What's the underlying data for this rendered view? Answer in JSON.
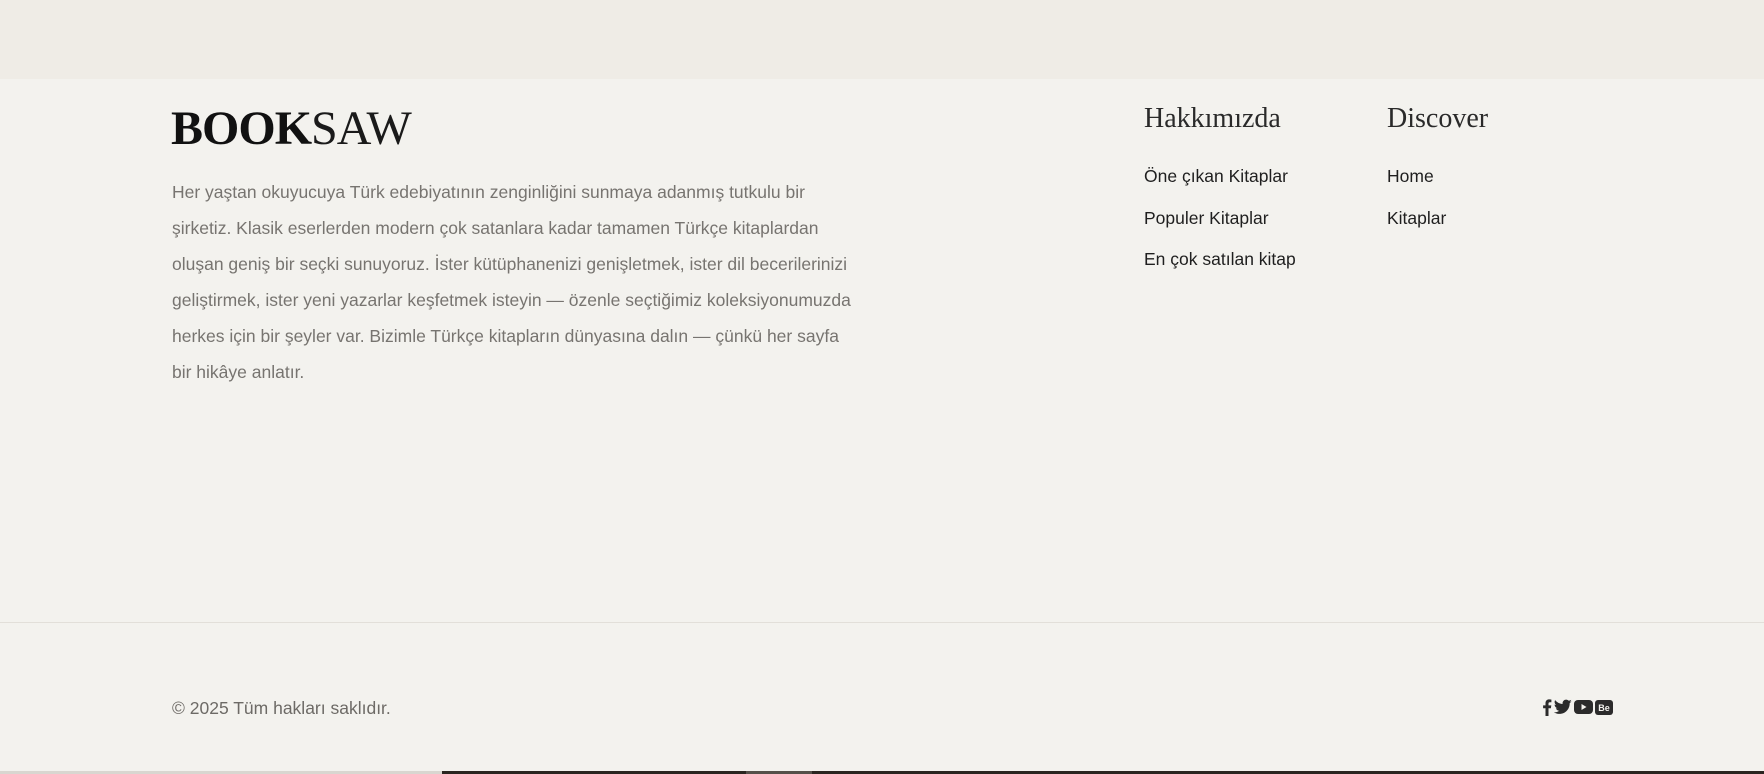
{
  "brand": {
    "logo_bold": "BOOK",
    "logo_light": "SAW"
  },
  "about": {
    "text": "Her yaştan okuyucuya Türk edebiyatının zenginliğini sunmaya adanmış tutkulu bir şirketiz. Klasik eserlerden modern çok satanlara kadar tamamen Türkçe kitaplardan oluşan geniş bir seçki sunuyoruz. İster kütüphanenizi genişletmek, ister dil becerilerinizi geliştirmek, ister yeni yazarlar keşfetmek isteyin — özenle seçtiğimiz koleksiyonumuzda herkes için bir şeyler var. Bizimle Türkçe kitapların dünyasına dalın — çünkü her sayfa bir hikâye anlatır."
  },
  "columns": {
    "about_us": {
      "title": "Hakkımızda",
      "links": [
        "Öne çıkan Kitaplar",
        "Populer Kitaplar",
        "En çok satılan kitap"
      ]
    },
    "discover": {
      "title": "Discover",
      "links": [
        "Home",
        "Kitaplar"
      ]
    }
  },
  "footer_bottom": {
    "copyright": "© 2025 Tüm hakları saklıdır."
  },
  "social": {
    "icons": [
      "facebook-icon",
      "twitter-icon",
      "youtube-icon",
      "behance-icon"
    ]
  },
  "colors": {
    "background": "#f3f2ee",
    "top_band": "#efece6",
    "text_muted": "#777470",
    "text_dark": "#1f1f1f"
  }
}
